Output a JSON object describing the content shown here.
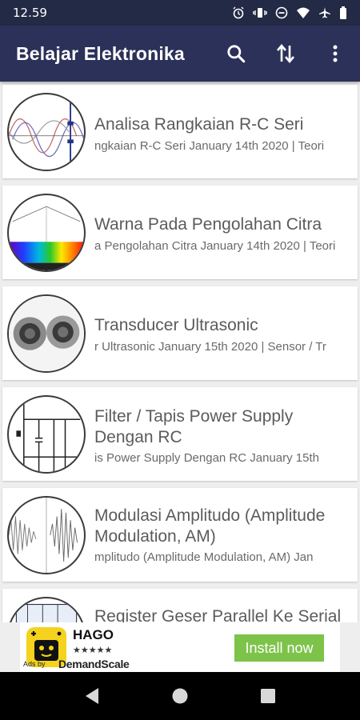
{
  "status_bar": {
    "time": "12.59"
  },
  "app_bar": {
    "title": "Belajar Elektronika",
    "actions": {
      "search": "search-icon",
      "sort": "swap-vertical-icon",
      "menu": "more-vert-icon"
    }
  },
  "articles": [
    {
      "title": "Analisa Rangkaian R-C Seri",
      "meta": "ngkaian R-C Seri January 14th 2020 | Teori"
    },
    {
      "title": "Warna Pada Pengolahan Citra",
      "meta": "a Pengolahan Citra January 14th 2020 | Teori"
    },
    {
      "title": "Transducer Ultrasonic",
      "meta": "r Ultrasonic January 15th 2020 | Sensor / Tr"
    },
    {
      "title": "Filter / Tapis Power Supply Dengan RC",
      "meta": "is Power Supply Dengan RC January 15th"
    },
    {
      "title": "Modulasi Amplitudo (Amplitude Modulation, AM)",
      "meta": "mplitudo (Amplitude Modulation, AM) Jan"
    },
    {
      "title": "Register Geser Parallel Ke Serial",
      "meta": ""
    }
  ],
  "ad": {
    "app_name": "HAGO",
    "stars": "★★★★★",
    "ads_by": "Ads by",
    "brand": "DemandScale",
    "install_label": "Install now",
    "button_color": "#7dc34a"
  },
  "colors": {
    "app_bar": "#2b3158",
    "status_bar": "#232a45"
  }
}
